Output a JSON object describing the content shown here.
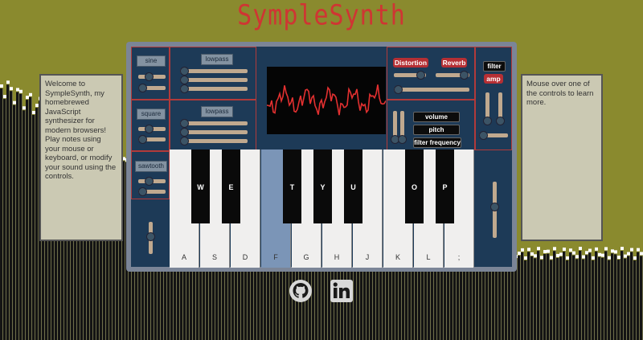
{
  "app": {
    "title": "SympleSynth"
  },
  "left_panel": {
    "text": "Welcome to SympleSynth, my homebrewed JavaScript synthesizer for modern browsers! Play notes using your mouse or keyboard, or modify your sound using the controls."
  },
  "right_panel": {
    "text": "Mouse over one of the controls to learn more."
  },
  "oscillators": {
    "sine": "sine",
    "square": "square",
    "sawtooth": "sawtooth"
  },
  "filters": {
    "lowpass_1": "lowpass",
    "lowpass_2": "lowpass"
  },
  "effects": {
    "distortion": "Distortion",
    "reverb": "Reverb"
  },
  "lfo": {
    "filter": "filter",
    "amp": "amp"
  },
  "envelope_labels": {
    "volume": "volume",
    "pitch": "pitch",
    "filter_frequency": "filter frequency"
  },
  "keyboard": {
    "white_keys": [
      "A",
      "S",
      "D",
      "F",
      "G",
      "H",
      "J",
      "K",
      "L",
      ";"
    ],
    "black_keys": [
      "W",
      "E",
      "T",
      "Y",
      "U",
      "O",
      "P"
    ],
    "active_key": "F"
  },
  "footer": {
    "icons": [
      "github-icon",
      "linkedin-icon"
    ]
  },
  "colors": {
    "background": "#8a8a2e",
    "accent": "#cf3533",
    "synth_body": "#1d3a57"
  }
}
